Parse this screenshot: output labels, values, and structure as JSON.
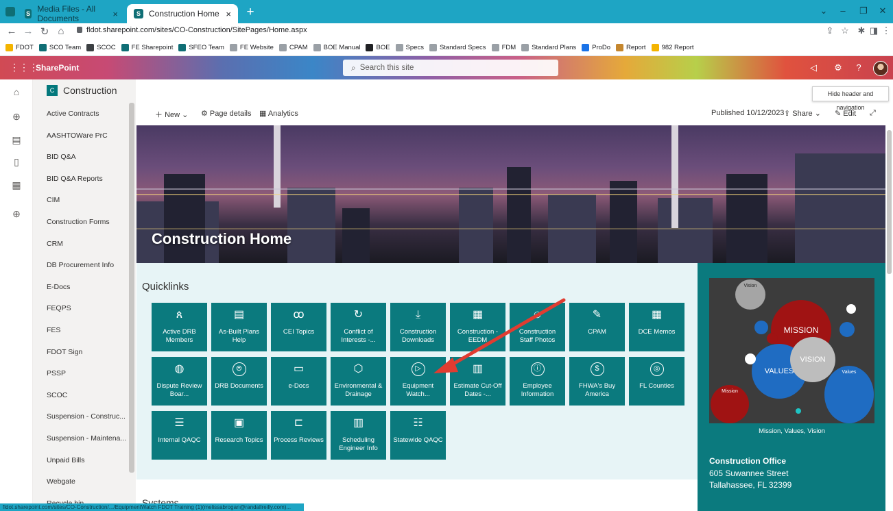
{
  "browser": {
    "tabs": [
      {
        "title": "Media Files - All Documents"
      },
      {
        "title": "Construction Home"
      }
    ],
    "url": "fldot.sharepoint.com/sites/CO-Construction/SitePages/Home.aspx",
    "bookmarks": [
      "FDOT",
      "SCO Team",
      "SCOC",
      "FE Sharepoint",
      "SFEO Team",
      "FE Website",
      "CPAM",
      "BOE Manual",
      "BOE",
      "Specs",
      "Standard Specs",
      "FDM",
      "Standard Plans",
      "ProDo",
      "Report",
      "982 Report"
    ],
    "status_text": "fldot.sharepoint.com/sites/CO-Construction/.../EquipmentWatch FDOT Training (1)(melissabrogan@randallreilly.com)..."
  },
  "suite": {
    "brand": "SharePoint",
    "search_placeholder": "Search this site"
  },
  "site": {
    "logo_letter": "C",
    "title": "Construction",
    "nav": [
      "Active Contracts",
      "AASHTOWare PrC",
      "BID Q&A",
      "BID Q&A Reports",
      "CIM",
      "Construction Forms",
      "CRM",
      "DB Procurement Info",
      "E-Docs",
      "FEQPS",
      "FES",
      "FDOT Sign",
      "PSSP",
      "SCOC",
      "Suspension - Construc...",
      "Suspension - Maintena...",
      "Unpaid Bills",
      "Webgate",
      "Recycle bin"
    ]
  },
  "commandbar": {
    "new": "New",
    "page_details": "Page details",
    "analytics": "Analytics",
    "published": "Published 10/12/2023",
    "share": "Share",
    "edit": "Edit",
    "tooltip": "Hide header and navigation"
  },
  "hero": {
    "title": "Construction Home"
  },
  "quicklinks": {
    "title": "Quicklinks",
    "tiles": [
      {
        "label": "Active DRB Members",
        "icon": "people-icon"
      },
      {
        "label": "As-Built Plans Help",
        "icon": "document-icon"
      },
      {
        "label": "CEI Topics",
        "icon": "group-icon"
      },
      {
        "label": "Conflict of Interests -...",
        "icon": "refresh-icon"
      },
      {
        "label": "Construction Downloads",
        "icon": "download-icon"
      },
      {
        "label": "Construction - EEDM",
        "icon": "spreadsheet-icon"
      },
      {
        "label": "Construction Staff Photos",
        "icon": "smiley-icon"
      },
      {
        "label": "CPAM",
        "icon": "edit-document-icon"
      },
      {
        "label": "DCE Memos",
        "icon": "memo-icon"
      },
      {
        "label": "Dispute Review Boar...",
        "icon": "search-help-icon"
      },
      {
        "label": "DRB Documents",
        "icon": "question-list-icon"
      },
      {
        "label": "e-Docs",
        "icon": "folder-doc-icon"
      },
      {
        "label": "Environmental & Drainage",
        "icon": "hexagon-icon"
      },
      {
        "label": "Equipment Watch...",
        "icon": "play-circle-icon"
      },
      {
        "label": "Estimate Cut-Off Dates -...",
        "icon": "calendar-clock-icon"
      },
      {
        "label": "Employee Information",
        "icon": "info-icon"
      },
      {
        "label": "FHWA's Buy America",
        "icon": "dollar-icon"
      },
      {
        "label": "FL Counties",
        "icon": "globe-icon"
      },
      {
        "label": "Internal QAQC",
        "icon": "lines-icon"
      },
      {
        "label": "Research Topics",
        "icon": "dashboard-icon"
      },
      {
        "label": "Process Reviews",
        "icon": "flow-icon"
      },
      {
        "label": "Scheduling Engineer Info",
        "icon": "calendar-edit-icon"
      },
      {
        "label": "Statewide QAQC",
        "icon": "bullet-list-icon"
      }
    ]
  },
  "right": {
    "bubbles": {
      "vision": "Vision",
      "mission": "MISSION",
      "values": "VALUES",
      "vision2": "VISION",
      "values_small": "Values",
      "mission_small": "Mission"
    },
    "caption": "Mission, Values, Vision",
    "office_title": "Construction Office",
    "address1": "605 Suwannee Street",
    "address2": "Tallahassee, FL 32399"
  },
  "systems": {
    "title": "Systems"
  },
  "colors": {
    "tile": "#0b7a7e",
    "accent": "#03787c",
    "arrow": "#e03c31"
  }
}
